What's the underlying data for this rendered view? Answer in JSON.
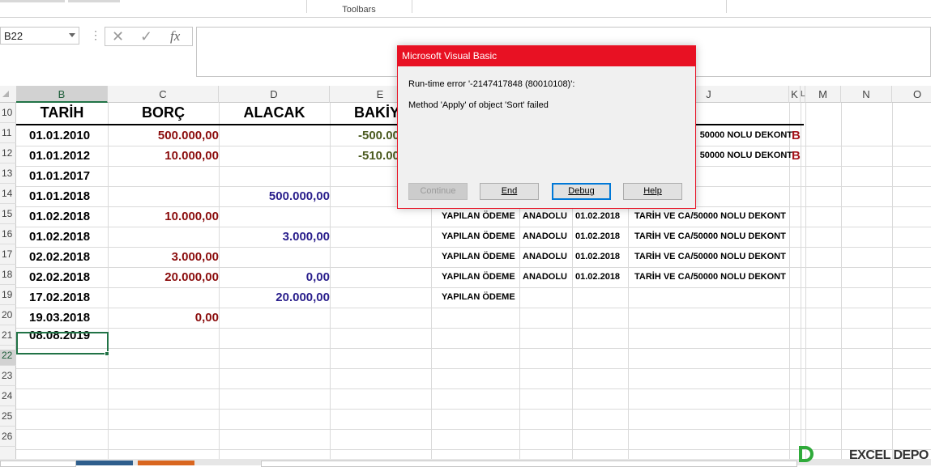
{
  "ribbon": {
    "group_label": "Toolbars"
  },
  "formula_bar": {
    "name_box": "B22",
    "fx_symbol": "fx",
    "cancel_symbol": "✕",
    "enter_symbol": "✓",
    "dots": "⋮"
  },
  "columns": [
    "B",
    "C",
    "D",
    "E",
    "J",
    "K",
    "L",
    "M",
    "N",
    "O"
  ],
  "rows": [
    "10",
    "11",
    "12",
    "13",
    "14",
    "15",
    "16",
    "17",
    "18",
    "19",
    "20",
    "21",
    "22",
    "23",
    "24",
    "25",
    "26"
  ],
  "selected": {
    "column": "B",
    "row": "22"
  },
  "sheet": {
    "headers": {
      "tarih": "TARİH",
      "borc": "BORÇ",
      "alacak": "ALACAK",
      "bakiye": "BAKİY"
    },
    "data_rows": [
      {
        "row": "11",
        "tarih": "01.01.2010",
        "borc": "500.000,00",
        "alacak": "",
        "bakiye": "-500.00",
        "aciklama": "",
        "banka": "",
        "tarih2": "",
        "dekont": "50000 NOLU DEKONT",
        "mark": "B"
      },
      {
        "row": "12",
        "tarih": "01.01.2012",
        "borc": "10.000,00",
        "alacak": "",
        "bakiye": "-510.00",
        "aciklama": "",
        "banka": "",
        "tarih2": "",
        "dekont": "50000 NOLU DEKONT",
        "mark": "B"
      },
      {
        "row": "13",
        "tarih": "01.01.2017",
        "borc": "",
        "alacak": "",
        "bakiye": "",
        "aciklama": "",
        "banka": "",
        "tarih2": "",
        "dekont": "",
        "mark": ""
      },
      {
        "row": "14",
        "tarih": "01.01.2018",
        "borc": "",
        "alacak": "500.000,00",
        "bakiye": "",
        "aciklama": "",
        "banka": "",
        "tarih2": "",
        "dekont": "",
        "mark": ""
      },
      {
        "row": "15",
        "tarih": "01.02.2018",
        "borc": "10.000,00",
        "alacak": "",
        "bakiye": "",
        "aciklama": "YAPILAN ÖDEME",
        "banka": "ANADOLU",
        "tarih2": "01.02.2018",
        "dekont": "TARİH VE CA/50000 NOLU DEKONT",
        "mark": ""
      },
      {
        "row": "16",
        "tarih": "01.02.2018",
        "borc": "",
        "alacak": "3.000,00",
        "bakiye": "",
        "aciklama": "YAPILAN ÖDEME",
        "banka": "ANADOLU",
        "tarih2": "01.02.2018",
        "dekont": "TARİH VE CA/50000 NOLU DEKONT",
        "mark": ""
      },
      {
        "row": "17",
        "tarih": "02.02.2018",
        "borc": "3.000,00",
        "alacak": "",
        "bakiye": "",
        "aciklama": "YAPILAN ÖDEME",
        "banka": "ANADOLU",
        "tarih2": "01.02.2018",
        "dekont": "TARİH VE CA/50000 NOLU DEKONT",
        "mark": ""
      },
      {
        "row": "18",
        "tarih": "02.02.2018",
        "borc": "20.000,00",
        "alacak": "0,00",
        "bakiye": "",
        "aciklama": "YAPILAN ÖDEME",
        "banka": "ANADOLU",
        "tarih2": "01.02.2018",
        "dekont": "TARİH VE CA/50000 NOLU DEKONT",
        "mark": ""
      },
      {
        "row": "19",
        "tarih": "17.02.2018",
        "borc": "",
        "alacak": "20.000,00",
        "bakiye": "",
        "aciklama": "YAPILAN ÖDEME",
        "banka": "",
        "tarih2": "",
        "dekont": "",
        "mark": ""
      },
      {
        "row": "20",
        "tarih": "19.03.2018",
        "borc": "0,00",
        "alacak": "",
        "bakiye": "",
        "aciklama": "",
        "banka": "",
        "tarih2": "",
        "dekont": "",
        "mark": ""
      },
      {
        "row": "21",
        "tarih": "08.08.2019",
        "borc": "",
        "alacak": "",
        "bakiye": "",
        "aciklama": "",
        "banka": "",
        "tarih2": "",
        "dekont": "",
        "mark": ""
      }
    ]
  },
  "dialog": {
    "title": "Microsoft Visual Basic",
    "line1": "Run-time error '-2147417848 (80010108)':",
    "line2": "Method 'Apply' of object 'Sort' failed",
    "buttons": {
      "continue": "Continue",
      "end": "End",
      "debug": "Debug",
      "help": "Help"
    }
  },
  "watermark": {
    "text": "EXCEL DEPO"
  },
  "colors": {
    "accent": "#217346",
    "dialog_title": "#e81123",
    "borc": "#8b0d0d",
    "alacak": "#2a1f8c",
    "bakiye": "#4b5a1f"
  }
}
